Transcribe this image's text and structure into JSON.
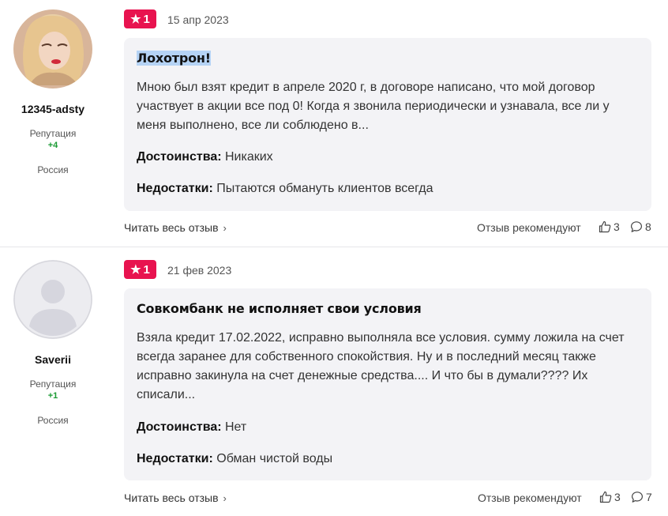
{
  "reviews": [
    {
      "author": {
        "name": "12345-adsty",
        "rep_label": "Репутация",
        "rep_value": "+4",
        "country": "Россия",
        "avatar": "user-photo"
      },
      "rating": "1",
      "date": "15 апр 2023",
      "title": "Лохотрон!",
      "text": "Мною был взят кредит в апреле 2020 г, в договоре написано, что мой договор участвует в акции все под 0! Когда я звонила периодически и узнавала, все ли у меня выполнено, все ли соблюдено в...",
      "pros_label": "Достоинства:",
      "pros": "Никаких",
      "cons_label": "Недостатки:",
      "cons": "Пытаются обмануть клиентов всегда",
      "read_more": "Читать весь отзыв",
      "recommend_label": "Отзыв рекомендуют",
      "likes": "3",
      "comments": "8"
    },
    {
      "author": {
        "name": "Saverii",
        "rep_label": "Репутация",
        "rep_value": "+1",
        "country": "Россия",
        "avatar": "default-avatar"
      },
      "rating": "1",
      "date": "21 фев 2023",
      "title": "Совкомбанк не исполняет свои условия",
      "text": "Взяла кредит 17.02.2022, исправно выполняла все условия. сумму ложила на счет всегда заранее для собственного спокойствия. Ну и в последний месяц также исправно закинула на счет денежные средства.... И что бы в думали???? Их списали...",
      "pros_label": "Достоинства:",
      "pros": "Нет",
      "cons_label": "Недостатки:",
      "cons": "Обман чистой воды",
      "read_more": "Читать весь отзыв",
      "recommend_label": "Отзыв рекомендуют",
      "likes": "3",
      "comments": "7"
    }
  ],
  "colors": {
    "badge": "#e8134f",
    "card_bg": "#f3f3f6",
    "rep_positive": "#1a9a33",
    "title_highlight": "#b5d3f5"
  },
  "icons": {
    "rating": "star-icon",
    "like": "thumbs-up-icon",
    "comment": "comment-bubble-icon",
    "read_more": "chevron-right-icon"
  }
}
